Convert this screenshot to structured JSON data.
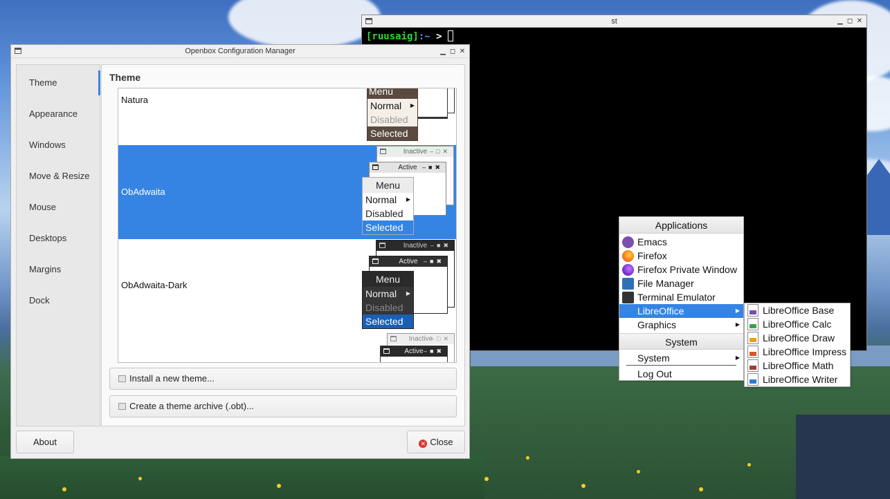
{
  "terminal": {
    "title": "st",
    "prompt_user": "[ruusaig]",
    "prompt_path": ":~",
    "prompt_symbol": " > "
  },
  "config_window": {
    "title": "Openbox Configuration Manager",
    "sidebar": {
      "items": [
        {
          "label": "Theme",
          "active": true
        },
        {
          "label": "Appearance"
        },
        {
          "label": "Windows"
        },
        {
          "label": "Move & Resize"
        },
        {
          "label": "Mouse"
        },
        {
          "label": "Desktops"
        },
        {
          "label": "Margins"
        },
        {
          "label": "Dock"
        }
      ]
    },
    "content": {
      "heading": "Theme",
      "themes": [
        {
          "name": "Natura"
        },
        {
          "name": "ObAdwaita",
          "selected": true
        },
        {
          "name": "ObAdwaita-Dark"
        }
      ],
      "preview": {
        "inactive": "Inactive",
        "active": "Active",
        "menu": "Menu",
        "normal": "Normal",
        "disabled": "Disabled",
        "selected": "Selected"
      },
      "install_button": "Install a new theme...",
      "archive_button": "Create a theme archive (.obt)..."
    },
    "about_button": "About",
    "close_button": "Close"
  },
  "root_menu": {
    "header_applications": "Applications",
    "items": [
      {
        "label": "Emacs",
        "icon": "emacs-icon"
      },
      {
        "label": "Firefox",
        "icon": "firefox-icon"
      },
      {
        "label": "Firefox Private Window",
        "icon": "firefox-private-icon"
      },
      {
        "label": "File Manager",
        "icon": "file-manager-icon"
      },
      {
        "label": "Terminal Emulator",
        "icon": "terminal-icon"
      },
      {
        "label": "LibreOffice",
        "selected": true
      },
      {
        "label": "Graphics"
      }
    ],
    "header_system": "System",
    "system_item": "System",
    "logout": "Log Out"
  },
  "libreoffice_menu": {
    "items": [
      {
        "label": "LibreOffice Base",
        "color": "#7b4ea3"
      },
      {
        "label": "LibreOffice Calc",
        "color": "#3aa34a"
      },
      {
        "label": "LibreOffice Draw",
        "color": "#e6a21a"
      },
      {
        "label": "LibreOffice Impress",
        "color": "#d9552b"
      },
      {
        "label": "LibreOffice Math",
        "color": "#a33a3a"
      },
      {
        "label": "LibreOffice Writer",
        "color": "#2a7bd1"
      }
    ]
  },
  "colors": {
    "accent": "#3584e4",
    "dark_selected": "#1a5fb4"
  }
}
